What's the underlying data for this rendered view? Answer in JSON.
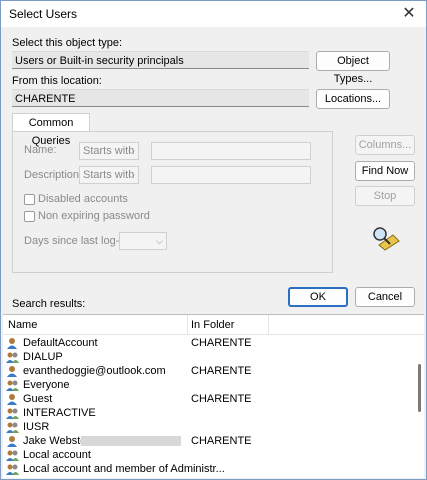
{
  "window": {
    "title": "Select Users"
  },
  "object_type": {
    "label": "Select this object type:",
    "value": "Users or Built-in security principals",
    "button": "Object Types..."
  },
  "location": {
    "label": "From this location:",
    "value": "CHARENTE",
    "button": "Locations..."
  },
  "queries": {
    "tab": "Common Queries",
    "name_label": "Name:",
    "name_mode": "Starts with",
    "desc_label": "Description:",
    "desc_mode": "Starts with",
    "disabled_accounts": "Disabled accounts",
    "non_expiring": "Non expiring password",
    "days_label": "Days since last log-on:"
  },
  "side_buttons": {
    "columns": "Columns...",
    "find_now": "Find Now",
    "stop": "Stop"
  },
  "search_results_label": "Search results:",
  "dialog_buttons": {
    "ok": "OK",
    "cancel": "Cancel"
  },
  "results": {
    "headers": {
      "name": "Name",
      "folder": "In Folder"
    },
    "rows": [
      {
        "name": "DefaultAccount",
        "folder": "CHARENTE",
        "icon": "user-icon"
      },
      {
        "name": "DIALUP",
        "folder": "",
        "icon": "group-icon"
      },
      {
        "name": "evanthedoggie@outlook.com",
        "folder": "CHARENTE",
        "icon": "user-icon"
      },
      {
        "name": "Everyone",
        "folder": "",
        "icon": "group-icon"
      },
      {
        "name": "Guest",
        "folder": "CHARENTE",
        "icon": "user-icon"
      },
      {
        "name": "INTERACTIVE",
        "folder": "",
        "icon": "group-icon"
      },
      {
        "name": "IUSR",
        "folder": "",
        "icon": "group-icon"
      },
      {
        "name": "Jake Webster",
        "folder": "CHARENTE",
        "icon": "user-icon"
      },
      {
        "name": "Local account",
        "folder": "",
        "icon": "group-icon"
      },
      {
        "name": "Local account and member of Administr...",
        "folder": "",
        "icon": "group-icon"
      }
    ]
  }
}
